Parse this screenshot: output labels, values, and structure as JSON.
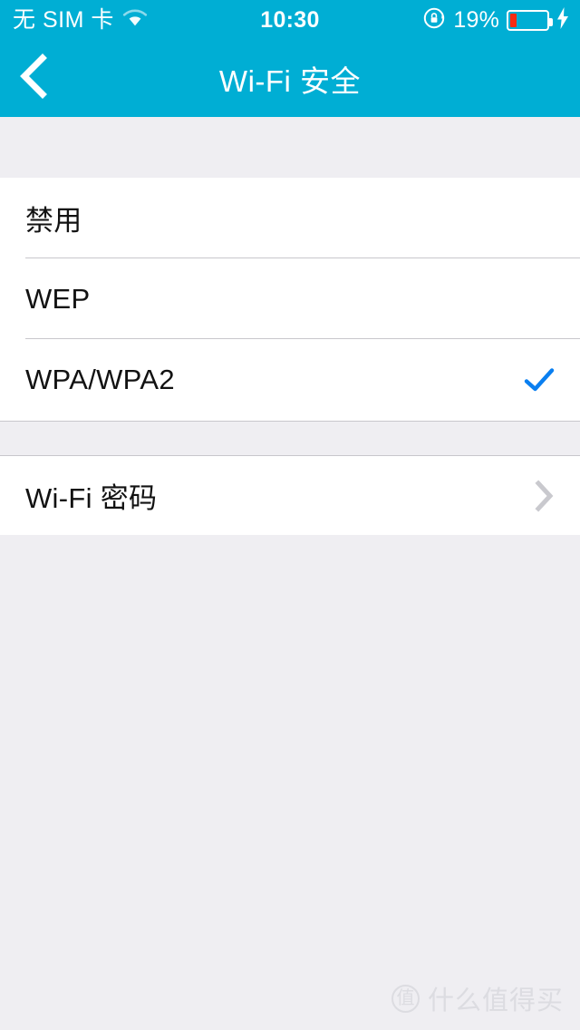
{
  "status_bar": {
    "carrier": "无 SIM 卡",
    "wifi_icon": "wifi-icon",
    "time": "10:30",
    "rotation_lock_icon": "rotation-lock-icon",
    "battery_percent": "19%",
    "battery_level": 19,
    "charging_icon": "lightning-bolt-icon",
    "battery_color": "#f82b13",
    "bar_color": "#00aed4",
    "text_color": "#ffffff"
  },
  "nav_bar": {
    "back_icon": "chevron-left-icon",
    "title": "Wi-Fi 安全"
  },
  "sections": {
    "security_options": {
      "rows": [
        {
          "label": "禁用",
          "selected": false
        },
        {
          "label": "WEP",
          "selected": false
        },
        {
          "label": "WPA/WPA2",
          "selected": true
        }
      ],
      "check_icon": "checkmark-icon",
      "check_color": "#0a7ff0"
    },
    "password": {
      "rows": [
        {
          "label": "Wi-Fi 密码",
          "accessory": "chevron-right-icon"
        }
      ],
      "chevron_color": "#c9c9ce"
    }
  },
  "watermark": {
    "badge_text": "值",
    "text": "什么值得买",
    "color": "#dcdce1"
  },
  "theme": {
    "accent": "#00aed4",
    "page_background": "#efeef2",
    "row_background": "#ffffff",
    "separator": "#c8c7cc",
    "label_text": "#121212"
  }
}
